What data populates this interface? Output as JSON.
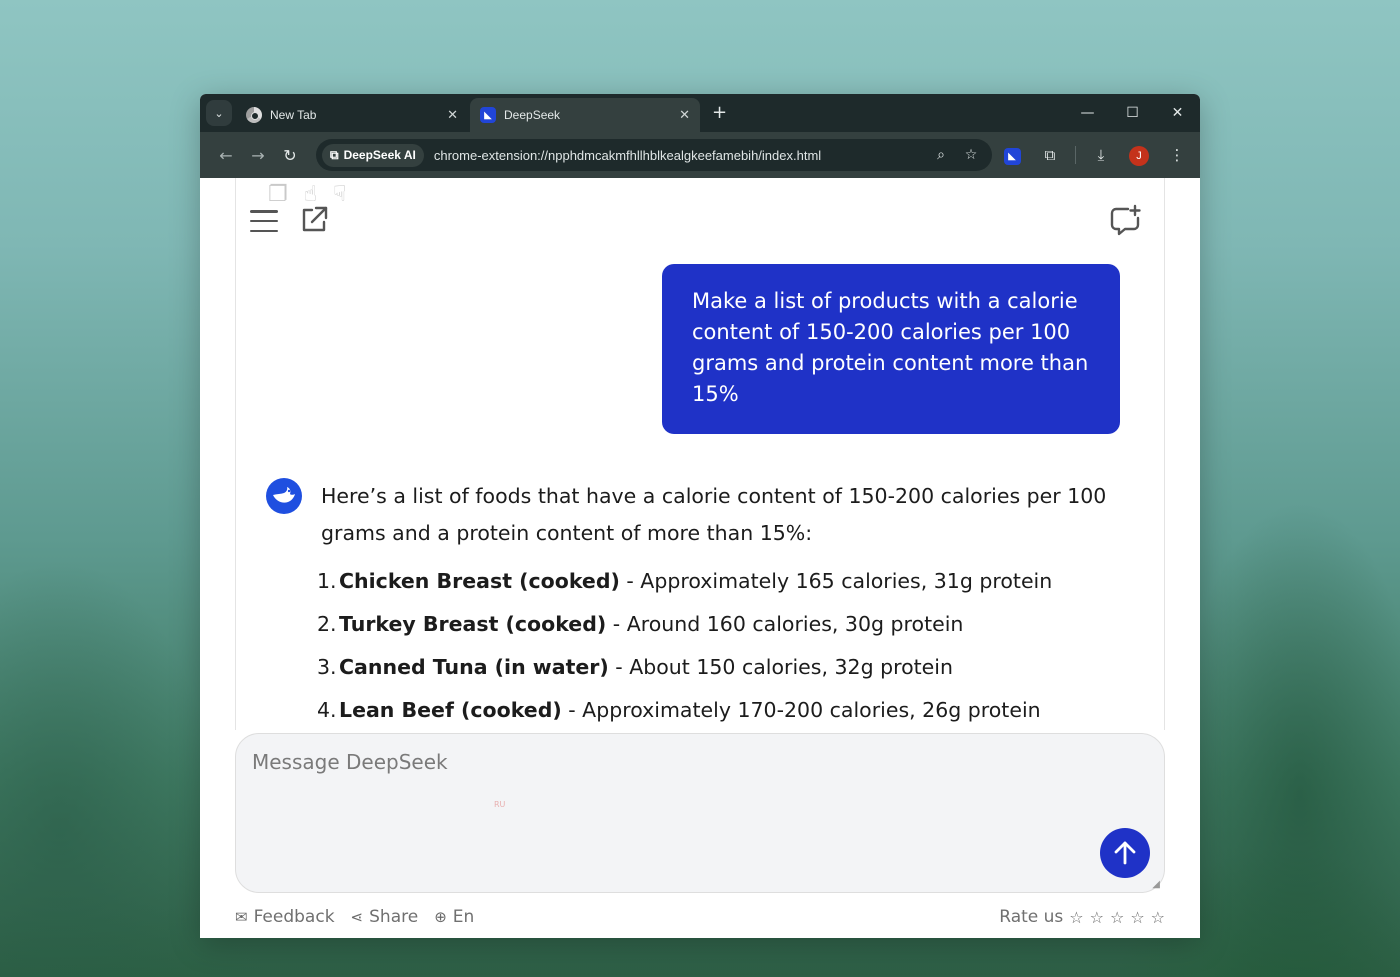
{
  "browser": {
    "tabs": [
      {
        "title": "New Tab",
        "icon": "chrome-icon"
      },
      {
        "title": "DeepSeek",
        "icon": "deepseek-icon"
      }
    ],
    "site_chip": "DeepSeek AI",
    "url": "chrome-extension://npphdmcakmfhllhblkealgkeefamebih/index.html",
    "profile_initial": "J"
  },
  "chat": {
    "user_message": "Make a list of products with a calorie content of 150-200 calories per 100 grams and protein content more than 15%",
    "assistant_intro": "Here’s a list of foods that have a calorie content of 150-200 calories per 100 grams and a protein content of more than 15%:",
    "assistant_items": [
      {
        "num": "1.",
        "name": "Chicken Breast (cooked)",
        "detail": " - Approximately 165 calories, 31g protein"
      },
      {
        "num": "2.",
        "name": "Turkey Breast (cooked)",
        "detail": " - Around 160 calories, 30g protein"
      },
      {
        "num": "3.",
        "name": "Canned Tuna (in water)",
        "detail": " - About 150 calories, 32g protein"
      },
      {
        "num": "4.",
        "name": "Lean Beef (cooked)",
        "detail": " - Approximately 170-200 calories, 26g protein"
      }
    ]
  },
  "composer": {
    "placeholder": "Message DeepSeek",
    "tiny_mark": "RU"
  },
  "footer": {
    "feedback": "Feedback",
    "share": "Share",
    "language": "En",
    "rate_label": "Rate us",
    "star_count": 5
  },
  "colors": {
    "accent": "#1f32c7",
    "tabbar": "#1e2a2b",
    "toolbar": "#34403f"
  }
}
